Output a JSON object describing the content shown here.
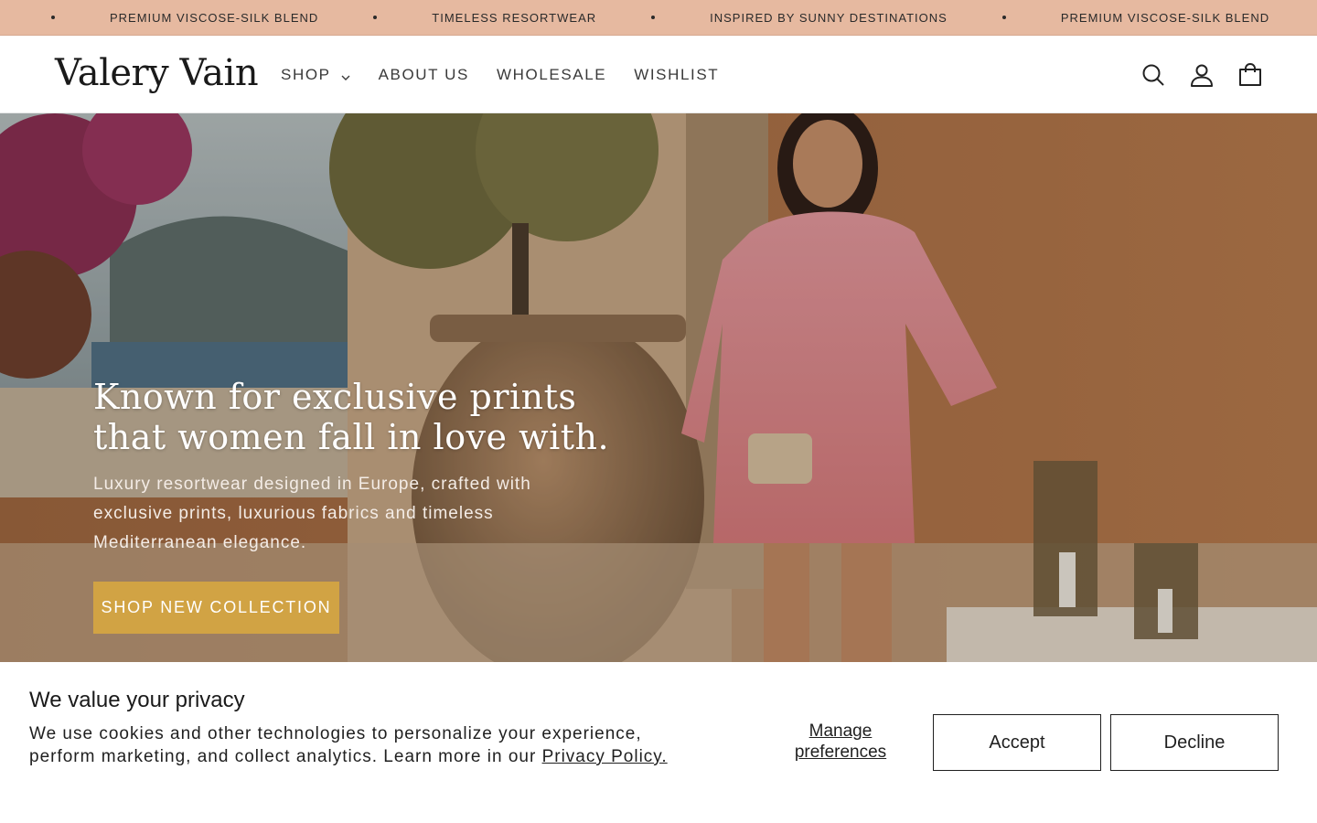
{
  "announcement": {
    "messages": [
      "PREMIUM VISCOSE-SILK BLEND",
      "TIMELESS RESORTWEAR",
      "INSPIRED BY SUNNY DESTINATIONS",
      "PREMIUM VISCOSE-SILK BLEND"
    ],
    "background": "#e6b9a0"
  },
  "header": {
    "logo": "Valery Vain",
    "nav": [
      {
        "label": "SHOP",
        "has_dropdown": true
      },
      {
        "label": "ABOUT US"
      },
      {
        "label": "WHOLESALE"
      },
      {
        "label": "WISHLIST"
      }
    ],
    "icons": [
      "search-icon",
      "account-icon",
      "cart-icon"
    ]
  },
  "hero": {
    "title": "Known for exclusive prints that women fall in love with.",
    "subtitle": "Luxury resortwear designed in Europe, crafted with exclusive prints, luxurious fabrics and timeless Mediterranean elegance.",
    "cta": "SHOP NEW COLLECTION",
    "cta_color": "#d1a344"
  },
  "cookie": {
    "title": "We value your privacy",
    "text": "We use cookies and other technologies to personalize your experience, perform marketing, and collect analytics. Learn more in our ",
    "link": "Privacy Policy.",
    "manage": "Manage preferences",
    "accept": "Accept",
    "decline": "Decline"
  }
}
